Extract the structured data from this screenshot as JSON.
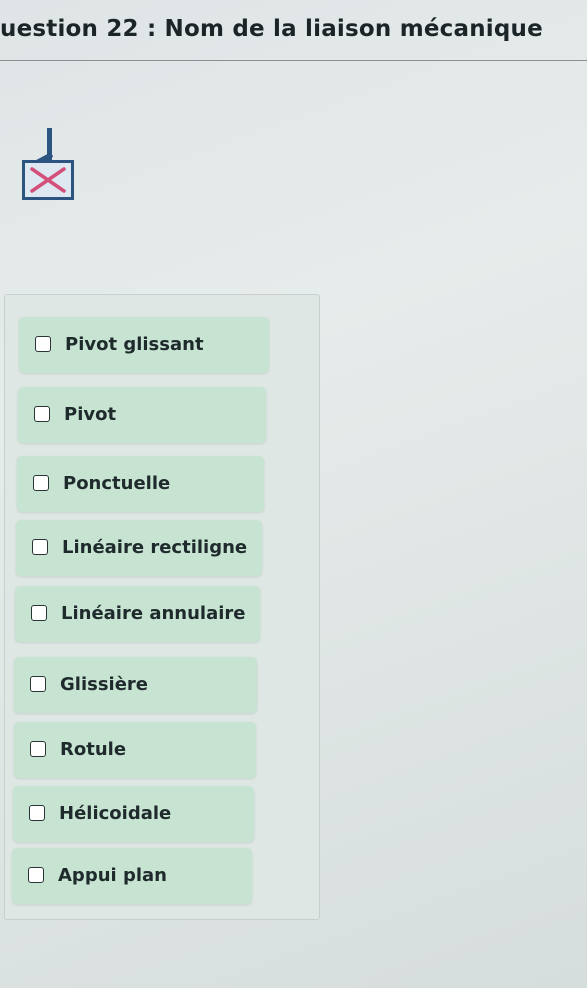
{
  "question": {
    "title": "uestion 22 : Nom de la liaison mécanique"
  },
  "figure": {
    "icon": "close-icon",
    "accent": "#2b5580",
    "cross_color": "#d2507a"
  },
  "options": [
    {
      "label": "Pivot glissant"
    },
    {
      "label": "Pivot"
    },
    {
      "label": "Ponctuelle"
    },
    {
      "label": "Linéaire rectiligne"
    },
    {
      "label": "Linéaire annulaire"
    },
    {
      "label": "Glissière"
    },
    {
      "label": "Rotule"
    },
    {
      "label": "Hélicoidale"
    },
    {
      "label": "Appui plan"
    }
  ],
  "colors": {
    "option_background": "#c7e3d2",
    "page_background": "#e2e8e8"
  }
}
